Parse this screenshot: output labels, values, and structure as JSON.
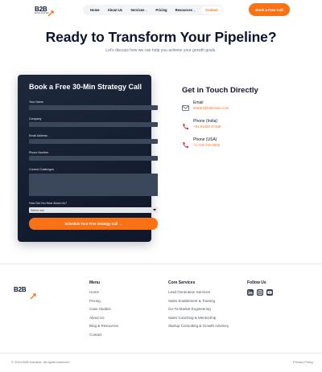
{
  "nav": {
    "logo": "B2B",
    "logo_sub": "EXCLUSIVE",
    "items": [
      {
        "label": "Home"
      },
      {
        "label": "About Us"
      },
      {
        "label": "Services",
        "caret": "⌄"
      },
      {
        "label": "Pricing"
      },
      {
        "label": "Resources",
        "caret": "⌄"
      },
      {
        "label": "Contact"
      }
    ],
    "cta": "Book a Free Call"
  },
  "hero": {
    "title": "Ready to Transform Your Pipeline?",
    "subtitle": "Let's discuss how we can help you achieve your growth goals."
  },
  "form": {
    "title": "Book a Free 30-Min Strategy Call",
    "fields": {
      "name": "Your Name",
      "company": "Company",
      "email": "Email Address",
      "phone": "Phone Number",
      "challenges": "Current Challenges",
      "source": "How Did You Hear About Us?"
    },
    "select_value": "Select one",
    "submit": "Schedule Your Free Strategy Call →"
  },
  "contact": {
    "title": "Get in Touch Directly",
    "items": [
      {
        "label": "Email",
        "value": "shawn@b2bclose.com",
        "icon": "mail-icon"
      },
      {
        "label": "Phone (India)",
        "value": "+91 91000 47259",
        "icon": "phone-icon"
      },
      {
        "label": "Phone (USA)",
        "value": "+1 718 734 6825",
        "icon": "phone-icon"
      }
    ]
  },
  "footer": {
    "logo": "B2B",
    "menu": {
      "title": "Menu",
      "links": [
        "Home",
        "Pricing",
        "Case Studies",
        "About Us",
        "Blog & Resources",
        "Contact"
      ]
    },
    "services": {
      "title": "Core Services",
      "links": [
        "Lead Generation Services",
        "Sales Enablement & Training",
        "Go-To-Market Engineering",
        "Sales Coaching & Mentorship",
        "Startup Consulting & Growth Advisory"
      ]
    },
    "follow": {
      "title": "Follow Us",
      "icons": [
        "linkedin-icon",
        "instagram-icon",
        "youtube-icon"
      ]
    },
    "copyright": "© 2024 B2B Xclusive. All rights reserved.",
    "privacy": "Privacy Policy"
  },
  "colors": {
    "accent": "#f97316",
    "navy": "#0b1530",
    "card": "#1e293b"
  }
}
